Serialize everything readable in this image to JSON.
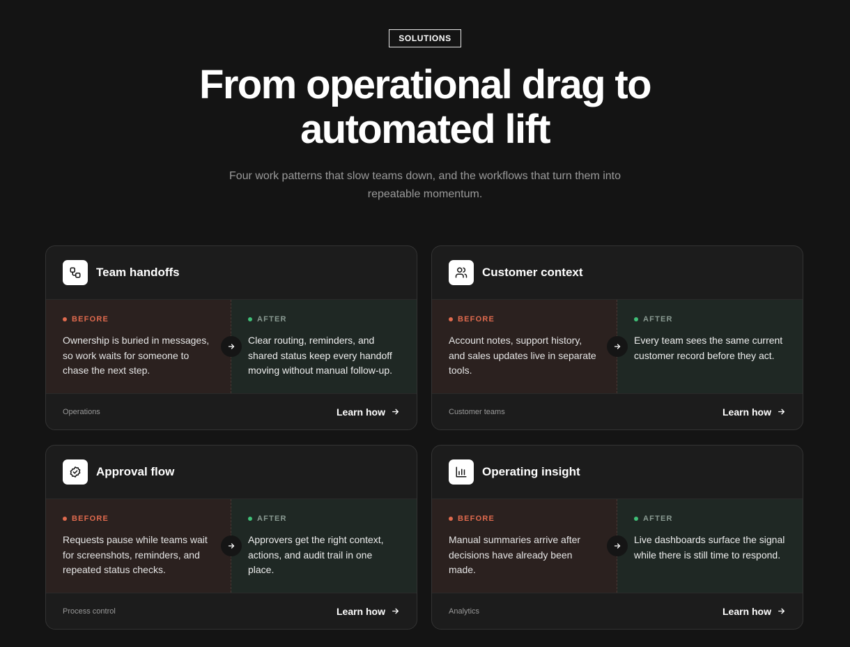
{
  "hero": {
    "badge": "SOLUTIONS",
    "title_line1": "From operational drag to",
    "title_line2": "automated lift",
    "subtitle": "Four work patterns that slow teams down, and the workflows that turn them into repeatable momentum."
  },
  "labels": {
    "before": "BEFORE",
    "after": "AFTER",
    "learn": "Learn how"
  },
  "colors": {
    "before_accent": "#e06a4e",
    "after_accent": "#3fbf77",
    "background": "#141414"
  },
  "cards": [
    {
      "title": "Team handoffs",
      "icon": "workflow-icon",
      "before": "Ownership is buried in messages, so work waits for someone to chase the next step.",
      "after": "Clear routing, reminders, and shared status keep every handoff moving without manual follow-up.",
      "tag": "Operations"
    },
    {
      "title": "Customer context",
      "icon": "users-icon",
      "before": "Account notes, support history, and sales updates live in separate tools.",
      "after": "Every team sees the same current customer record before they act.",
      "tag": "Customer teams"
    },
    {
      "title": "Approval flow",
      "icon": "badge-check-icon",
      "before": "Requests pause while teams wait for screenshots, reminders, and repeated status checks.",
      "after": "Approvers get the right context, actions, and audit trail in one place.",
      "tag": "Process control"
    },
    {
      "title": "Operating insight",
      "icon": "bar-chart-icon",
      "before": "Manual summaries arrive after decisions have already been made.",
      "after": "Live dashboards surface the signal while there is still time to respond.",
      "tag": "Analytics"
    }
  ]
}
